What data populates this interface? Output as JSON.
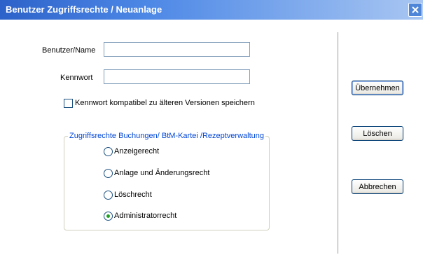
{
  "window": {
    "title": "Benutzer Zugriffsrechte / Neuanlage",
    "close_label": "×"
  },
  "form": {
    "username": {
      "label": "Benutzer/Name",
      "value": ""
    },
    "password": {
      "label": "Kennwort",
      "value": ""
    },
    "compat_checkbox": {
      "label": "Kennwort kompatibel zu älteren Versionen speichern",
      "checked": false
    }
  },
  "access_group": {
    "legend": "Zugriffsrechte Buchungen/ BtM-Kartei /Rezeptverwaltung",
    "options": [
      {
        "label": "Anzeigerecht",
        "selected": false
      },
      {
        "label": "Anlage und Änderungsrecht",
        "selected": false
      },
      {
        "label": "Löschrecht",
        "selected": false
      },
      {
        "label": "Administratorrecht",
        "selected": true
      }
    ]
  },
  "buttons": {
    "apply": "Übernehmen",
    "delete": "Löschen",
    "cancel": "Abbrechen"
  },
  "colors": {
    "titlebar_start": "#2c62c9",
    "titlebar_end": "#a8c6f2",
    "group_legend": "#0046d5",
    "radio_selected": "#21a121"
  }
}
